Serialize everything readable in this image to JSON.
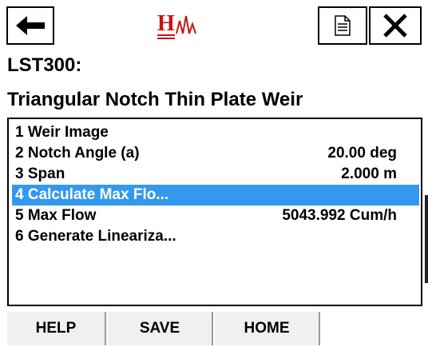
{
  "header": {
    "back_icon": "left-arrow-icon",
    "logo_text": "H",
    "doc_icon": "document-icon",
    "close_icon": "close-x-icon"
  },
  "device": "LST300:",
  "mode": "Triangular Notch Thin Plate Weir",
  "menu": {
    "items": [
      {
        "label": "1 Weir Image",
        "value": ""
      },
      {
        "label": "2 Notch Angle (a)",
        "value": "20.00 deg"
      },
      {
        "label": "3 Span",
        "value": "2.000 m"
      },
      {
        "label": "4 Calculate Max Flo...",
        "value": ""
      },
      {
        "label": "5 Max Flow",
        "value": "5043.992 Cum/h"
      },
      {
        "label": "6 Generate Lineariza...",
        "value": ""
      }
    ],
    "selected_index": 3
  },
  "softkeys": {
    "help": "HELP",
    "save": "SAVE",
    "home": "HOME"
  },
  "colors": {
    "accent": "#3399ee",
    "logo": "#cc1111"
  }
}
